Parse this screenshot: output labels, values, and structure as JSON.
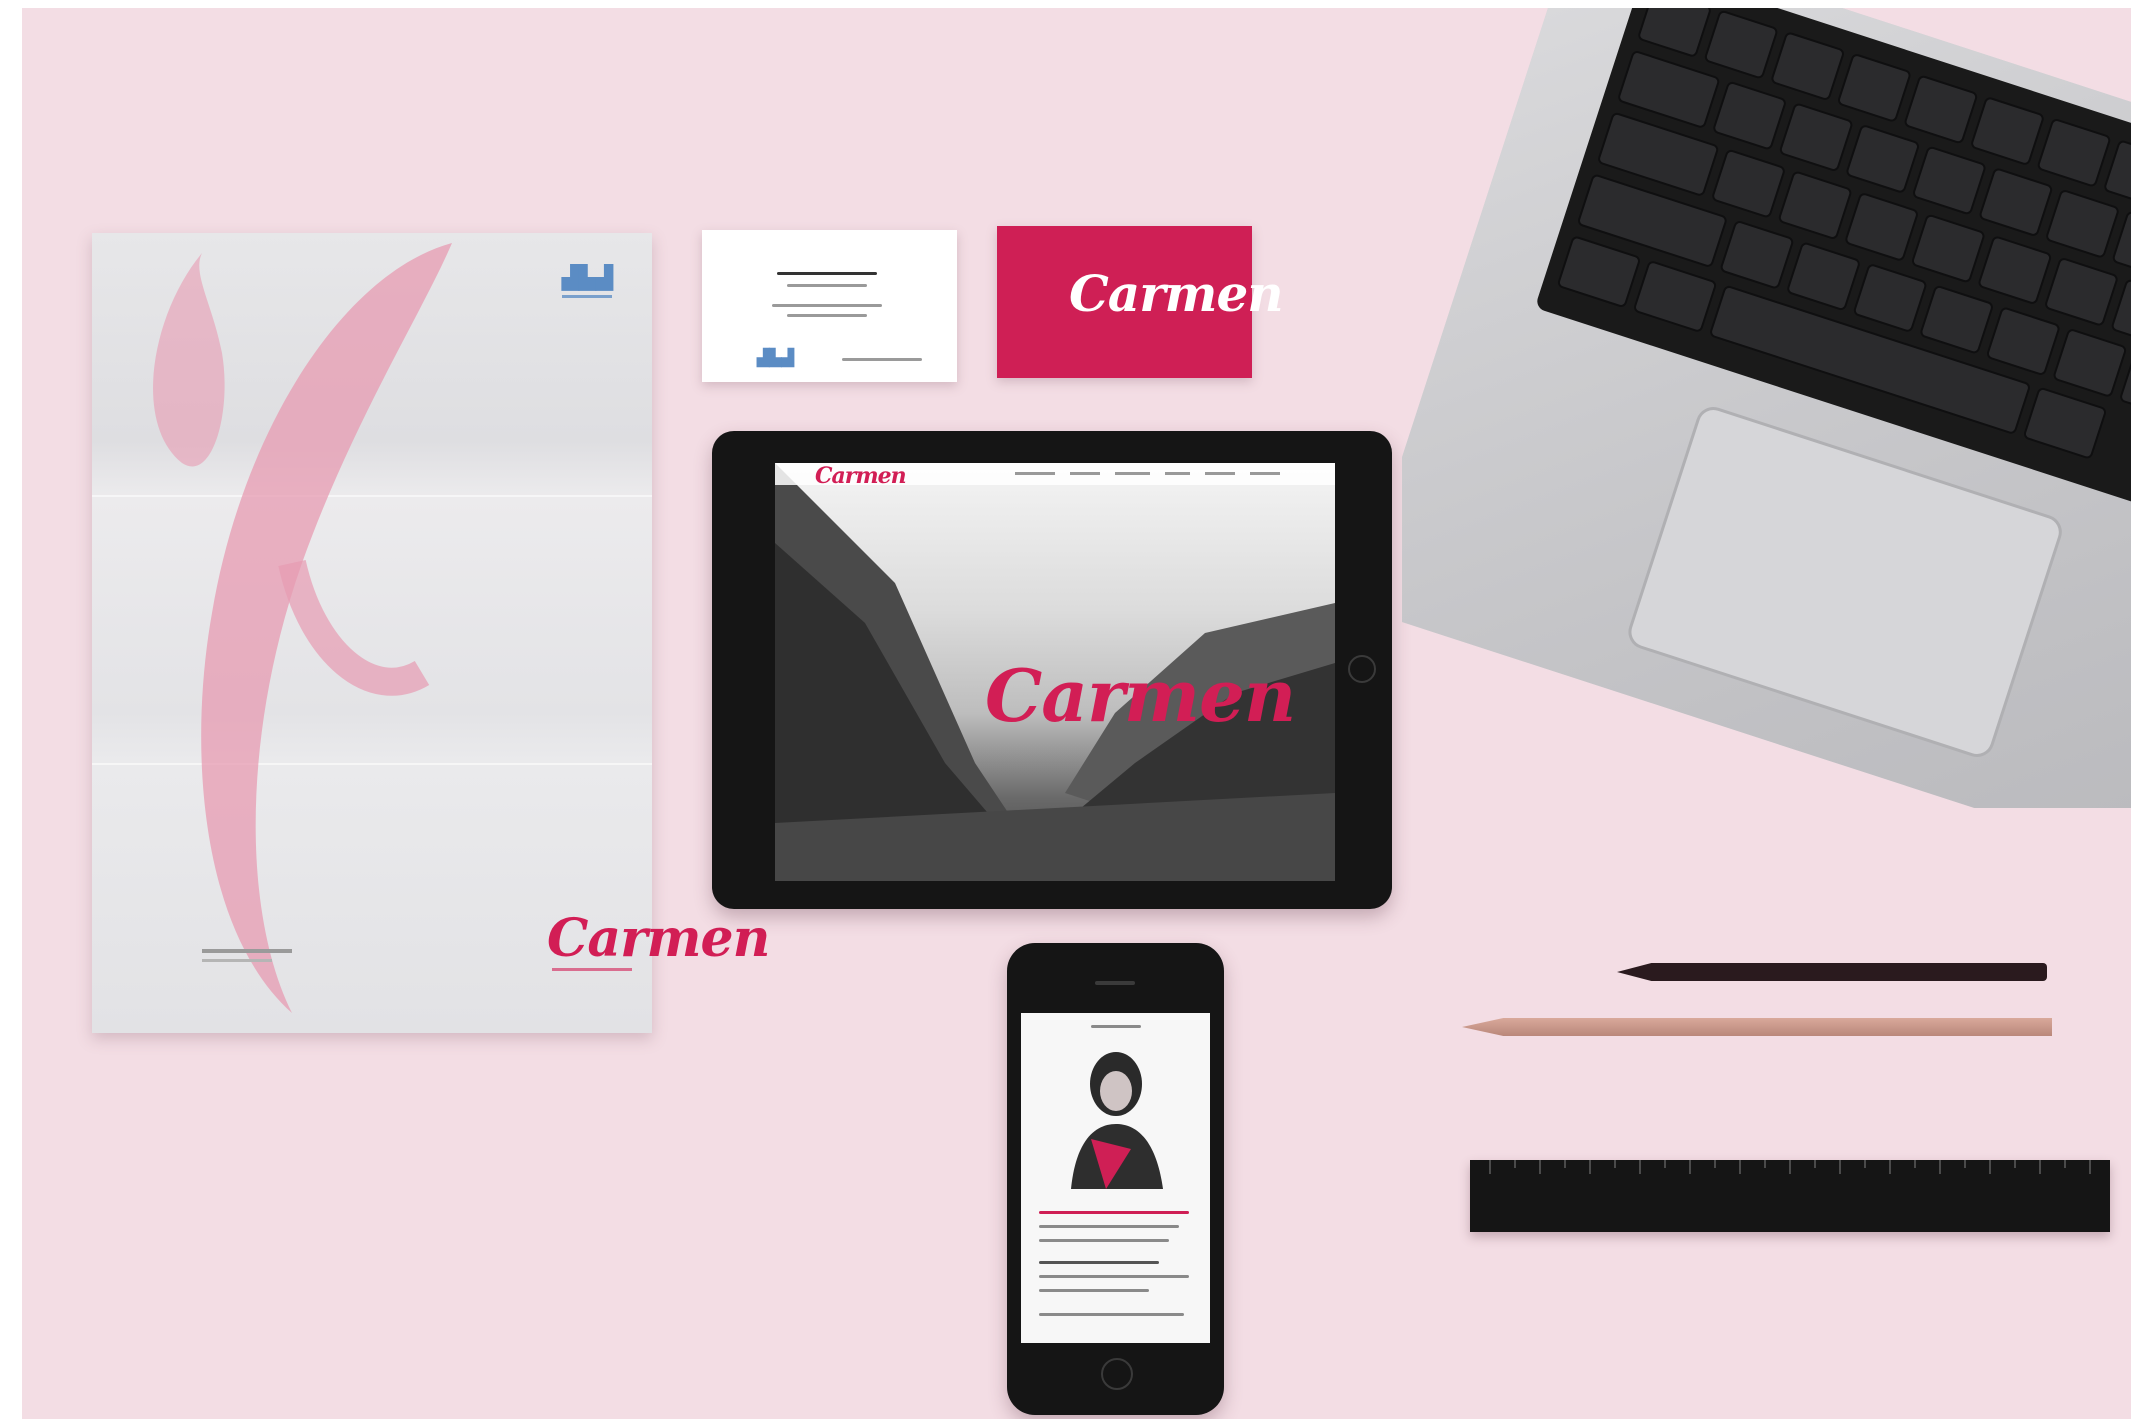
{
  "brand": {
    "name": "Carmen",
    "accent_color": "#cf1f55",
    "background_color": "#f3dde4"
  }
}
